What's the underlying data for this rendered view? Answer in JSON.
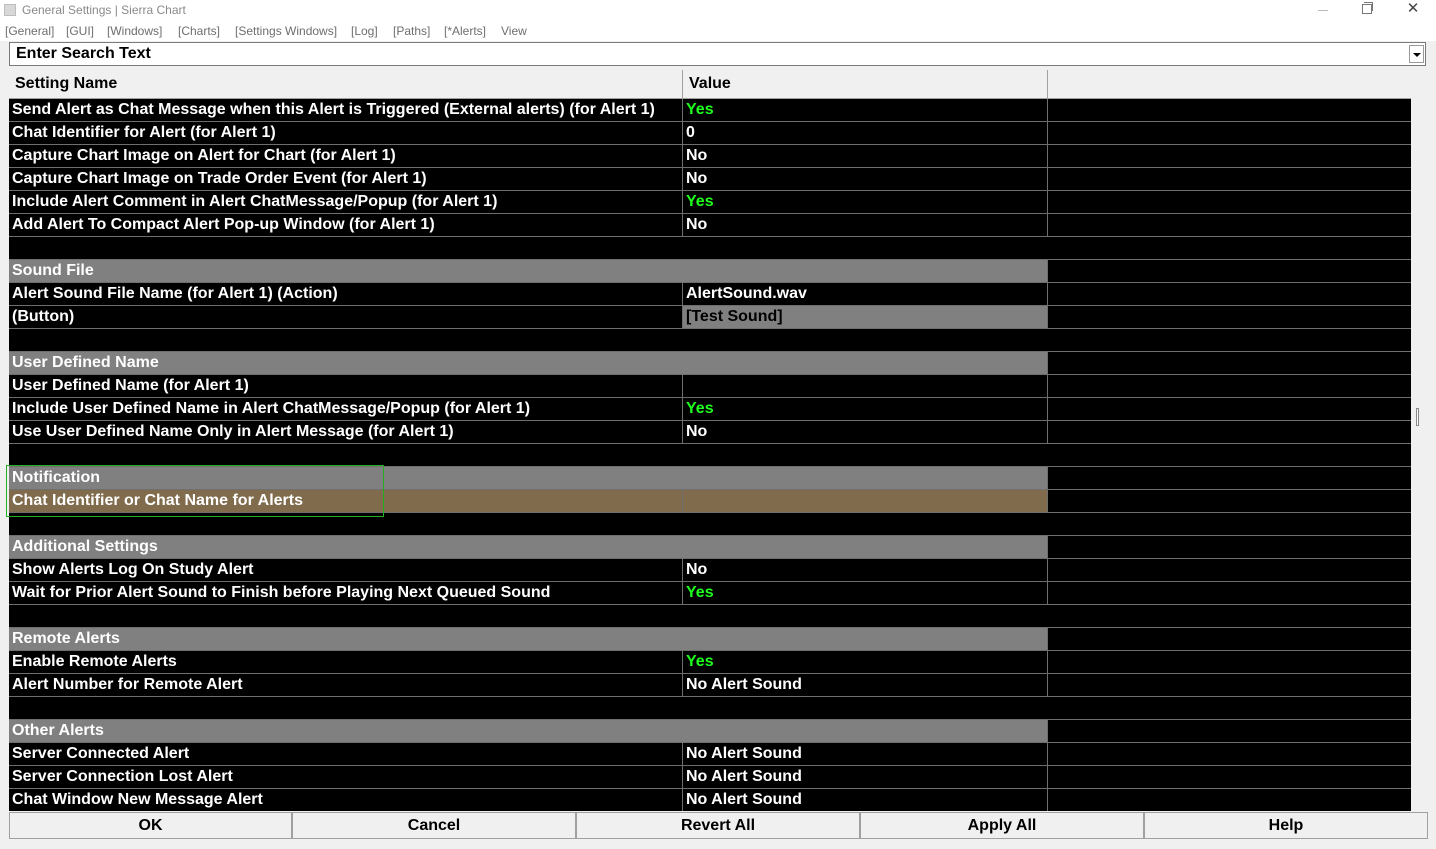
{
  "window": {
    "title": "General Settings | Sierra Chart"
  },
  "menu": [
    "[General]",
    "[GUI]",
    "[Windows]",
    "[Charts]",
    "[Settings Windows]",
    "[Log]",
    "[Paths]",
    "[*Alerts]",
    "View"
  ],
  "search": {
    "text": "Enter Search Text"
  },
  "grid": {
    "headers": {
      "name": "Setting Name",
      "value": "Value"
    },
    "rows": [
      {
        "kind": "item",
        "name": "Send Alert as Chat Message when this Alert is Triggered (External alerts) (for Alert 1)",
        "value": "Yes"
      },
      {
        "kind": "item",
        "name": "Chat Identifier for Alert (for Alert 1)",
        "value": "0"
      },
      {
        "kind": "item",
        "name": "Capture Chart Image on Alert for Chart (for Alert 1)",
        "value": "No"
      },
      {
        "kind": "item",
        "name": "Capture Chart Image on Trade Order Event (for Alert 1)",
        "value": "No"
      },
      {
        "kind": "item",
        "name": "Include Alert Comment in Alert ChatMessage/Popup (for Alert 1)",
        "value": "Yes"
      },
      {
        "kind": "item",
        "name": "Add Alert To Compact Alert Pop-up Window (for Alert 1)",
        "value": "No"
      },
      {
        "kind": "blank"
      },
      {
        "kind": "section",
        "name": "Sound File"
      },
      {
        "kind": "item",
        "name": "Alert Sound File Name (for Alert 1) (Action)",
        "value": "AlertSound.wav"
      },
      {
        "kind": "button",
        "name": " (Button)",
        "value": "[Test Sound]"
      },
      {
        "kind": "blank"
      },
      {
        "kind": "section",
        "name": "User Defined Name"
      },
      {
        "kind": "item",
        "name": "User Defined Name (for Alert 1)",
        "value": ""
      },
      {
        "kind": "item",
        "name": "Include User Defined Name in Alert ChatMessage/Popup (for Alert 1)",
        "value": "Yes"
      },
      {
        "kind": "item",
        "name": "Use User Defined Name Only in Alert Message (for Alert 1)",
        "value": "No"
      },
      {
        "kind": "blank"
      },
      {
        "kind": "section",
        "name": "Notification"
      },
      {
        "kind": "selected",
        "name": "Chat Identifier or Chat Name for Alerts",
        "value": ""
      },
      {
        "kind": "blank"
      },
      {
        "kind": "section",
        "name": "Additional Settings"
      },
      {
        "kind": "item",
        "name": "Show Alerts Log On Study Alert",
        "value": "No"
      },
      {
        "kind": "item",
        "name": "Wait for Prior Alert Sound to Finish before Playing Next Queued Sound",
        "value": "Yes"
      },
      {
        "kind": "blank"
      },
      {
        "kind": "section",
        "name": "Remote Alerts"
      },
      {
        "kind": "item",
        "name": "Enable Remote Alerts",
        "value": "Yes"
      },
      {
        "kind": "item",
        "name": "Alert Number for Remote Alert",
        "value": "No Alert Sound"
      },
      {
        "kind": "blank"
      },
      {
        "kind": "section",
        "name": "Other Alerts"
      },
      {
        "kind": "item",
        "name": "Server Connected Alert",
        "value": "No Alert Sound"
      },
      {
        "kind": "item",
        "name": "Server Connection Lost Alert",
        "value": "No Alert Sound"
      },
      {
        "kind": "item",
        "name": "Chat Window New Message Alert",
        "value": "No Alert Sound"
      }
    ]
  },
  "buttons": {
    "ok": "OK",
    "cancel": "Cancel",
    "revert_all": "Revert All",
    "apply_all": "Apply All",
    "help": "Help"
  },
  "colors": {
    "yes_value": "#1fff1f",
    "section_bg": "#808080",
    "selected_bg": "#806c4d",
    "grid_bg": "#000000",
    "focus_border": "#22b022"
  }
}
